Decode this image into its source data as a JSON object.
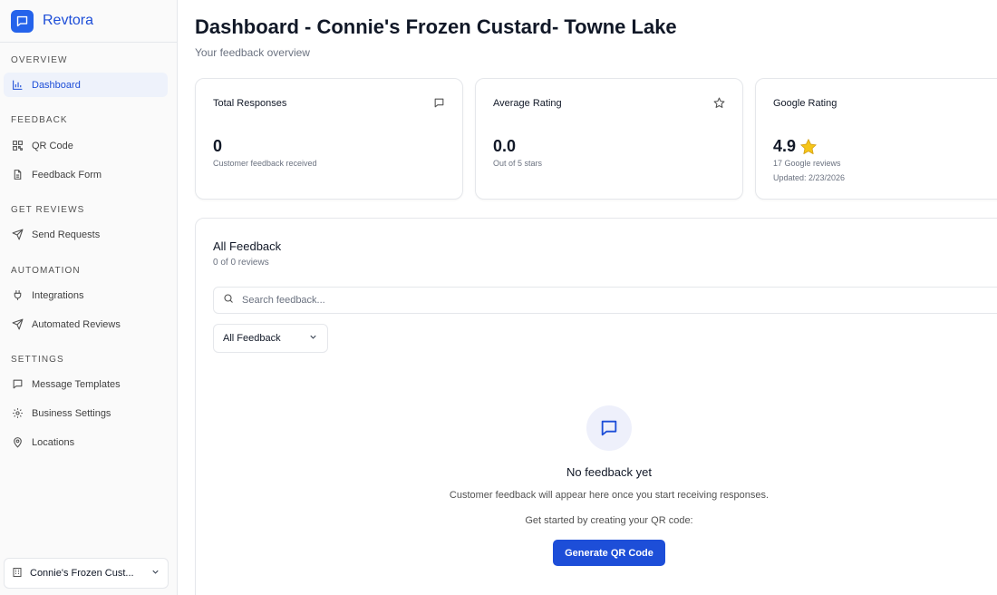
{
  "brand": {
    "name": "Revtora",
    "logo_icon": "chat-bubble-icon",
    "color": "#1d4ed8"
  },
  "sidebar": {
    "sections": [
      {
        "title": "OVERVIEW",
        "items": [
          {
            "label": "Dashboard",
            "icon": "bar-chart-icon",
            "active": true
          }
        ]
      },
      {
        "title": "FEEDBACK",
        "items": [
          {
            "label": "QR Code",
            "icon": "qr-code-icon"
          },
          {
            "label": "Feedback Form",
            "icon": "document-icon"
          }
        ]
      },
      {
        "title": "GET REVIEWS",
        "items": [
          {
            "label": "Send Requests",
            "icon": "send-icon"
          }
        ]
      },
      {
        "title": "AUTOMATION",
        "items": [
          {
            "label": "Integrations",
            "icon": "plug-icon"
          },
          {
            "label": "Automated Reviews",
            "icon": "send-icon"
          }
        ]
      },
      {
        "title": "SETTINGS",
        "items": [
          {
            "label": "Message Templates",
            "icon": "message-icon"
          },
          {
            "label": "Business Settings",
            "icon": "gear-icon"
          },
          {
            "label": "Locations",
            "icon": "map-pin-icon"
          }
        ]
      }
    ],
    "location_selector": {
      "value": "Connie's Frozen Cust...",
      "icon": "building-icon"
    }
  },
  "header": {
    "title": "Dashboard - Connie's Frozen Custard- Towne Lake",
    "subtitle": "Your feedback overview"
  },
  "stats": {
    "total": {
      "label": "Total Responses",
      "value": "0",
      "desc": "Customer feedback received",
      "icon": "message-icon"
    },
    "average": {
      "label": "Average Rating",
      "value": "0.0",
      "desc": "Out of 5 stars",
      "icon": "star-outline-icon"
    },
    "google": {
      "label": "Google Rating",
      "value": "4.9",
      "desc": "17 Google reviews",
      "updated": "Updated: 2/23/2026",
      "icon": "globe-icon"
    }
  },
  "feedback": {
    "title": "All Feedback",
    "count": "0 of 0 reviews",
    "search_placeholder": "Search feedback...",
    "filter_value": "All Feedback",
    "empty_title": "No feedback yet",
    "empty_desc": "Customer feedback will appear here once you start receiving responses.",
    "empty_hint": "Get started by creating your QR code:",
    "cta_label": "Generate QR Code"
  },
  "colors": {
    "accent": "#1d4ed8",
    "star": "#f5c518"
  }
}
